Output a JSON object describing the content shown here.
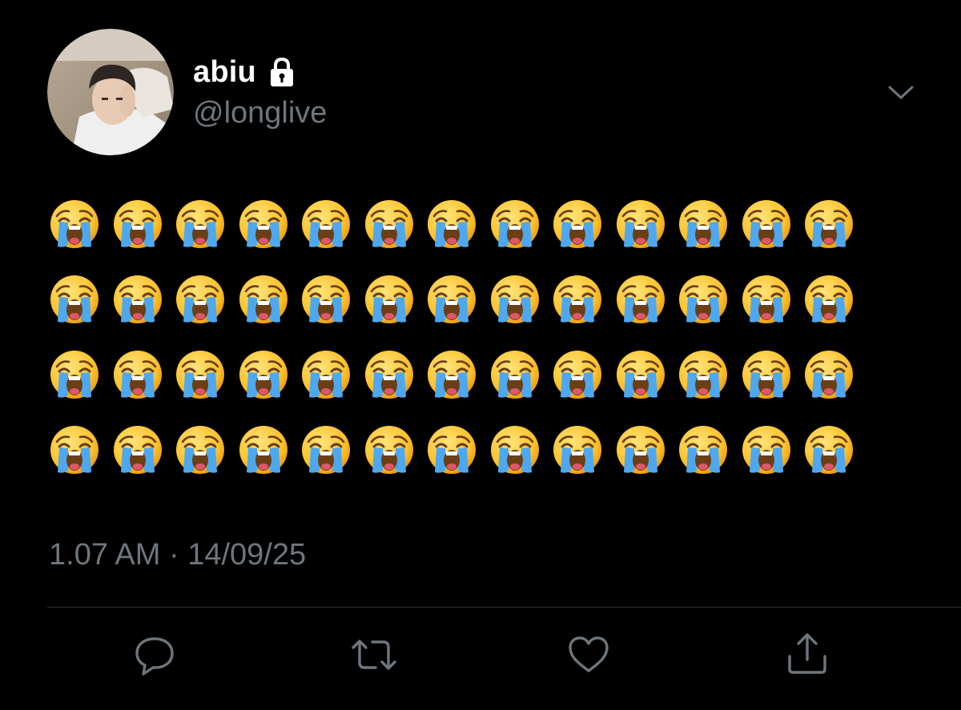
{
  "tweet": {
    "author": {
      "display_name": "abiu",
      "handle": "@longlive",
      "verified_icon": "lock-icon",
      "avatar": "profile-photo"
    },
    "body": {
      "emoji": "😭",
      "emoji_name": "loudly-crying-face",
      "rows": 4,
      "per_row": 13
    },
    "timestamp": "1.07 AM · 14/09/25",
    "menu_icon": "chevron-down-icon",
    "actions": [
      {
        "name": "reply",
        "icon": "speech-bubble-icon"
      },
      {
        "name": "retweet",
        "icon": "retweet-arrows-icon"
      },
      {
        "name": "like",
        "icon": "heart-outline-icon"
      },
      {
        "name": "share",
        "icon": "share-upload-icon"
      }
    ]
  },
  "colors": {
    "background": "#000000",
    "primary_text": "#ffffff",
    "secondary_text": "#6e767d",
    "divider": "#2f3336",
    "icon_gray": "#6e767d"
  }
}
